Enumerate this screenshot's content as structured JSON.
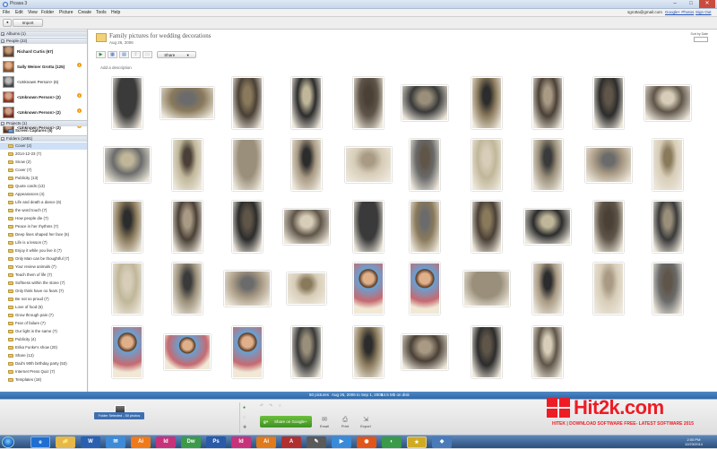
{
  "window": {
    "title": "Picasa 3",
    "min": "–",
    "max": "□",
    "close": "✕"
  },
  "menu": {
    "items": [
      "File",
      "Edit",
      "View",
      "Folder",
      "Picture",
      "Create",
      "Tools",
      "Help"
    ],
    "account_email": "sgrotta@gmail.com",
    "google_plus": "Google+ Photos",
    "sign_out": "Sign Out"
  },
  "toolbar": {
    "import_label": "Import",
    "filter_label": "Filters",
    "search_placeholder": "",
    "back": "◂",
    "forward": "▸"
  },
  "sidebar": {
    "albums": "Albums (1)",
    "people_header": "People (22)",
    "people": [
      {
        "name": "Richard Curtis (67)",
        "warn": false
      },
      {
        "name": "Sally Weiner Grotta (125)",
        "warn": true
      },
      {
        "name": "<Unknown Person> (6)",
        "warn": false
      },
      {
        "name": "<Unknown Person> (2)",
        "warn": true
      },
      {
        "name": "<Unknown Person> (2)",
        "warn": true
      },
      {
        "name": "<Unknown Person> (2)",
        "warn": true
      }
    ],
    "projects": "Projects (1)",
    "screen_captures": "Screen Captures (6)",
    "folders_header": "Folders (1681)",
    "folders": [
      "Cover (2)",
      "2014-12-23 (7)",
      "Snow (2)",
      "Cover (7)",
      "Publicity (13)",
      "Quote cards (13)",
      "Appearances (4)",
      "Life and death a dance (6)",
      "the word touch (7)",
      "How people die (7)",
      "Peace in her rhythms (7)",
      "Deep lines shaped her face (6)",
      "Life is a lesson (7)",
      "Enjoy it while you live it (7)",
      "Only Man can be thoughtful (7)",
      "Your review animals (7)",
      "Teach them of life (7)",
      "Softness within the stone (7)",
      "Only think have no fears (7)",
      "Be not so proud (7)",
      "Love of food (6)",
      "Grow through pain (7)",
      "Fear of failure (7)",
      "Our light is the same (7)",
      "Publicity (4)",
      "Erika Funke's show (20)",
      "Share (12)",
      "Dad's 90th birthday party (53)",
      "Internet Press Quiz (7)",
      "Templates (18)"
    ]
  },
  "album": {
    "title": "Family pictures for wedding decorations",
    "date": "Aug 26, 2006",
    "description_placeholder": "Add a description",
    "share_label": "Share",
    "sort_label": "Sort by Date"
  },
  "photos": {
    "count": 48
  },
  "status": {
    "summary": "50 pictures",
    "range": "Aug 26, 2006 to Sep 1, 2008",
    "size": "14.5 Mb on disk"
  },
  "tray": {
    "selected": "Folder Selected - 50 photos",
    "share_google": "Share on Google+",
    "email": "Email",
    "print": "Print",
    "export": "Export"
  },
  "taskbar": {
    "time": "2:00 PM",
    "date": "12/23/2014",
    "apps": [
      "e",
      "📁",
      "W",
      "✉",
      "Ai",
      "Id",
      "Dw",
      "Ps",
      "Id",
      "Ai",
      "A",
      "✎",
      "▶",
      "◉",
      "◐",
      "★",
      "◆"
    ]
  },
  "watermark": {
    "brand": "Hit2k.com",
    "tagline": "HITEK | DOWNLOAD SOFTWARE FREE- LATEST SOFTWARE 2015"
  },
  "colors": {
    "accent": "#2f68a8",
    "share_green": "#4da42a",
    "warn": "#f29b13",
    "watermark": "#ee1c25"
  }
}
